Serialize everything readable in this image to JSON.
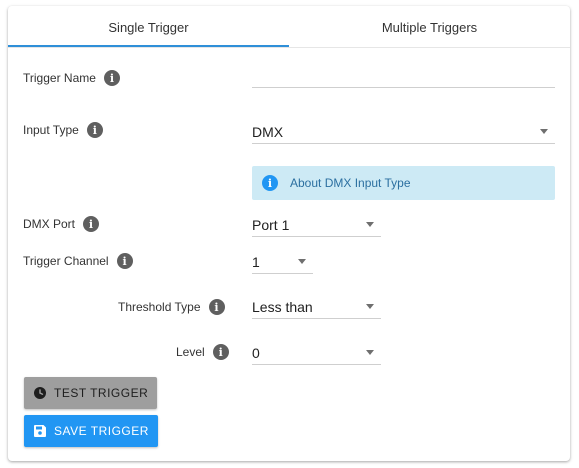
{
  "tabs": [
    {
      "label": "Single Trigger",
      "active": true
    },
    {
      "label": "Multiple Triggers",
      "active": false
    }
  ],
  "form": {
    "trigger_name": {
      "label": "Trigger Name",
      "value": ""
    },
    "input_type": {
      "label": "Input Type",
      "value": "DMX"
    },
    "info_banner": {
      "text": "About DMX Input Type"
    },
    "dmx_port": {
      "label": "DMX Port",
      "value": "Port 1"
    },
    "trigger_channel": {
      "label": "Trigger Channel",
      "value": "1"
    },
    "threshold_type": {
      "label": "Threshold Type",
      "value": "Less than"
    },
    "level": {
      "label": "Level",
      "value": "0"
    }
  },
  "buttons": {
    "test_label": "TEST TRIGGER",
    "save_label": "SAVE TRIGGER"
  },
  "icons": {
    "info": "info-icon",
    "test": "test-icon",
    "save": "save-icon",
    "caret": "chevron-down-icon"
  },
  "colors": {
    "accent": "#2196f3",
    "tab_indicator": "#2f8fd8",
    "banner_bg": "#cdeaf5",
    "test_button_bg": "#9e9e9e"
  }
}
